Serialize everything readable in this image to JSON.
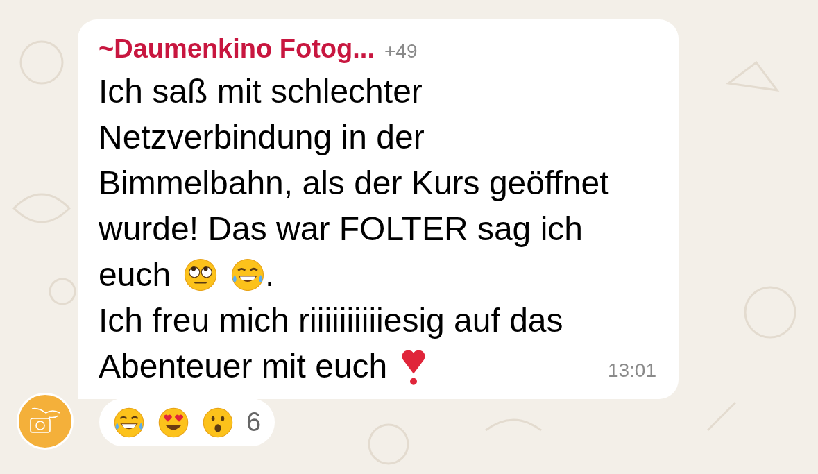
{
  "message": {
    "sender_prefix": "~",
    "sender": "Daumenkino Fotog...",
    "phone": "+49",
    "lines": [
      {
        "text": "Ich saß mit schlechter"
      },
      {
        "text": "Netzverbindung in der"
      },
      {
        "text": "Bimmelbahn, als der Kurs geöffnet"
      },
      {
        "text": "wurde! Das war FOLTER sag ich"
      },
      {
        "text": "euch",
        "emojis": [
          {
            "kind": "rolling-eyes"
          },
          {
            "kind": "joy"
          }
        ],
        "after": "."
      },
      {
        "text": "Ich freu mich riiiiiiiiiiesig auf das"
      },
      {
        "text": "Abenteuer mit euch",
        "emojis": [
          {
            "kind": "heart-exclamation"
          }
        ]
      }
    ],
    "time": "13:01"
  },
  "reactions": {
    "emojis": [
      {
        "kind": "joy"
      },
      {
        "kind": "heart-eyes"
      },
      {
        "kind": "surprised"
      }
    ],
    "count": "6"
  }
}
